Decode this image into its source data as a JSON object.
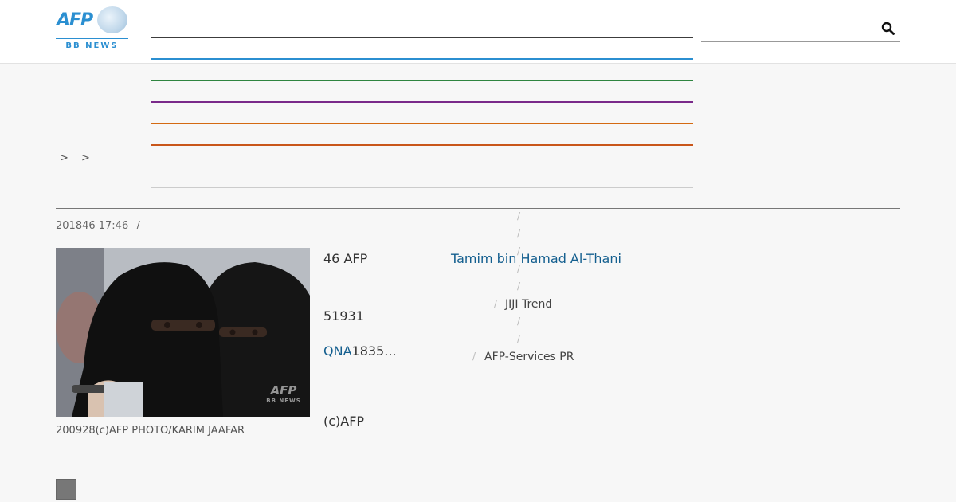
{
  "header": {
    "logo_text": "AFP",
    "logo_subtext": "BB NEWS",
    "nav_colors": [
      "#3c3c3c",
      "#2b8fd1",
      "#2e8540",
      "#7a2a8a",
      "#d46a12",
      "#c9561a"
    ],
    "search_icon": "search-icon"
  },
  "breadcrumb": {
    "text": "> >"
  },
  "article": {
    "title": "",
    "date": "201846 17:46",
    "meta_separator": "/",
    "photo": {
      "watermark": "AFP",
      "watermark_sub": "BB NEWS",
      "caption": "200928(c)AFP PHOTO/KARIM JAAFAR"
    },
    "paragraphs": {
      "p1": "46 AFP",
      "p1_link": "Tamim bin Hamad Al-Thani",
      "p2": "51931",
      "p3_link": "QNA",
      "p3": "1835...",
      "p4": "(c)AFP"
    }
  },
  "sidebar": {
    "separator": "/",
    "item_1": "JIJI Trend",
    "item_2": "AFP-Services PR"
  }
}
